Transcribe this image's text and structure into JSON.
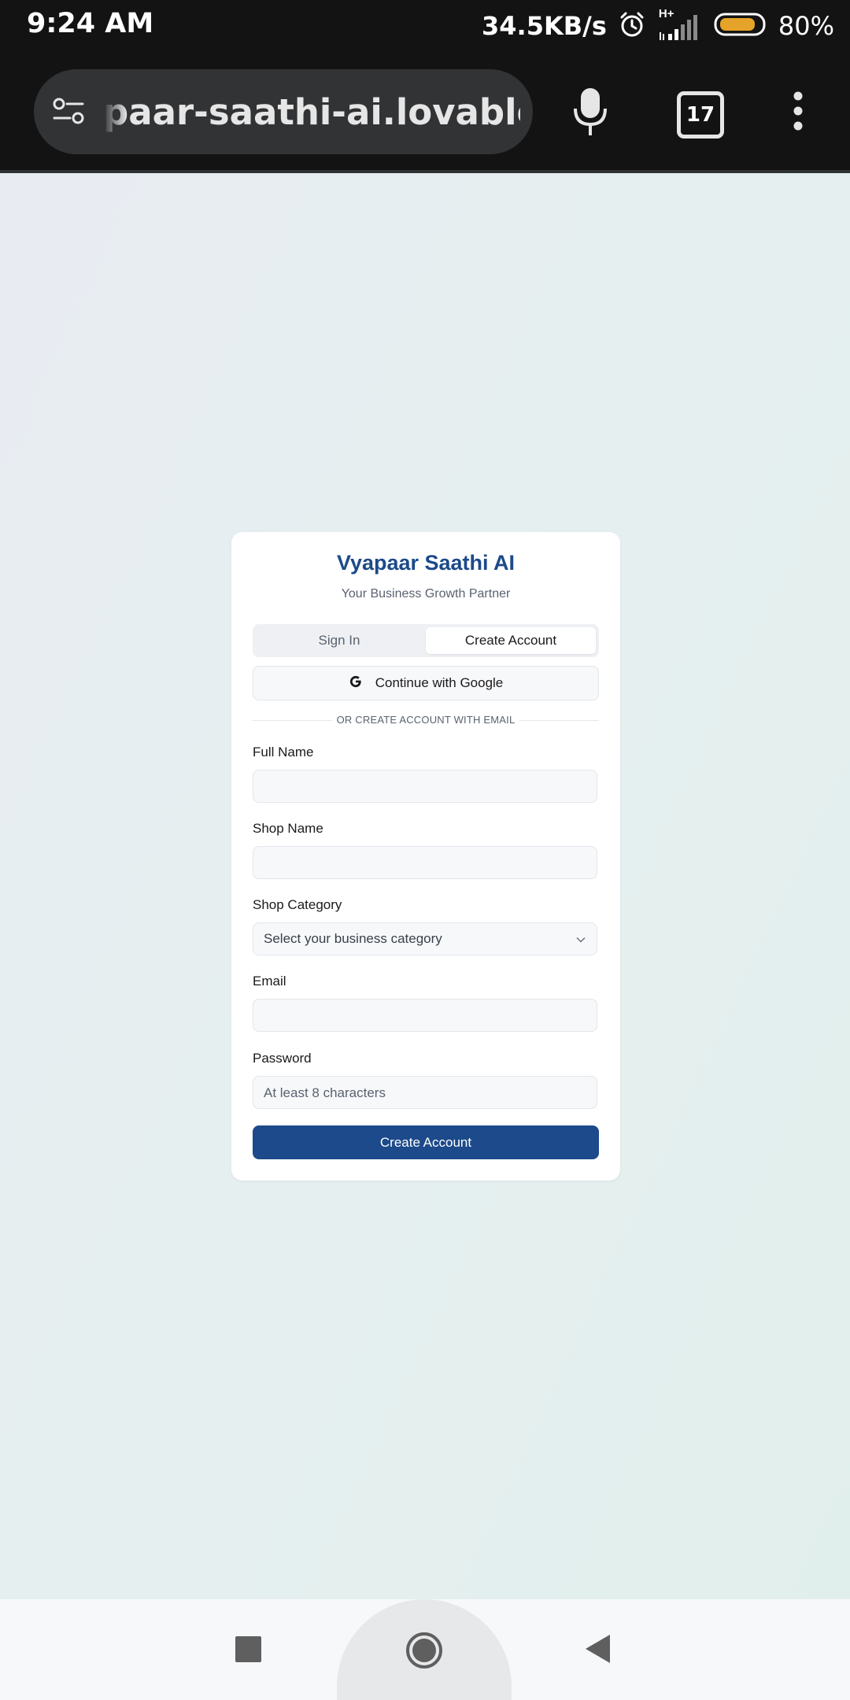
{
  "status_bar": {
    "time": "9:24 AM",
    "net_speed": "34.5KB/s",
    "network_type": "H+",
    "battery_percent": "80%",
    "battery_color": "#e6a32a"
  },
  "browser": {
    "url": "paar-saathi-ai.lovable.app",
    "tab_count": "17"
  },
  "card": {
    "title": "Vyapaar Saathi AI",
    "subtitle": "Your Business Growth Partner",
    "tabs": [
      {
        "label": "Sign In",
        "active": false
      },
      {
        "label": "Create Account",
        "active": true
      }
    ],
    "google_button": "Continue with Google",
    "divider_text": "OR CREATE ACCOUNT WITH EMAIL",
    "fields": {
      "full_name": {
        "label": "Full Name",
        "value": "",
        "placeholder": ""
      },
      "shop_name": {
        "label": "Shop Name",
        "value": "",
        "placeholder": ""
      },
      "shop_category": {
        "label": "Shop Category",
        "selected": "Select your business category"
      },
      "email": {
        "label": "Email",
        "value": "",
        "placeholder": ""
      },
      "password": {
        "label": "Password",
        "value": "",
        "placeholder": "At least 8 characters"
      }
    },
    "submit_label": "Create Account",
    "accent_color": "#1c4a8a"
  }
}
